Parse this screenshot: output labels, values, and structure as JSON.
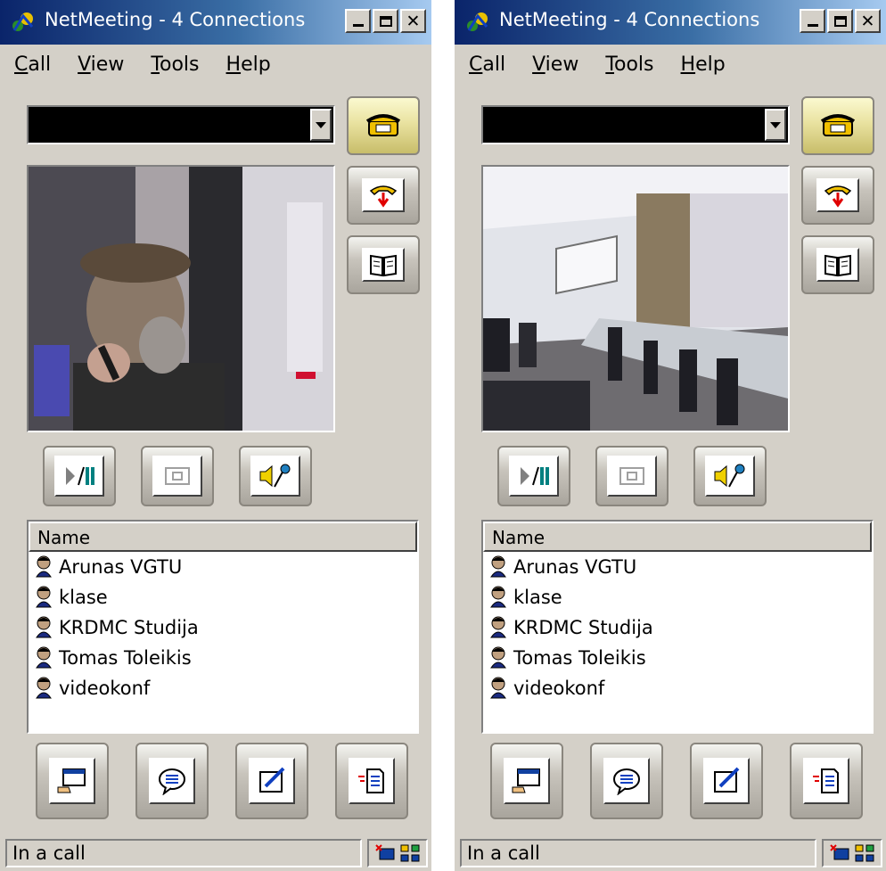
{
  "windows": [
    {
      "title": "NetMeeting - 4 Connections",
      "menu": [
        "Call",
        "View",
        "Tools",
        "Help"
      ],
      "list_header": "Name",
      "participants": [
        "Arunas VGTU",
        "klase",
        "KRDMC Studija",
        "Tomas Toleikis",
        "videokonf"
      ],
      "status": "In a call",
      "video_scene": "person-at-desk"
    },
    {
      "title": "NetMeeting - 4 Connections",
      "menu": [
        "Call",
        "View",
        "Tools",
        "Help"
      ],
      "list_header": "Name",
      "participants": [
        "Arunas VGTU",
        "klase",
        "KRDMC Studija",
        "Tomas Toleikis",
        "videokonf"
      ],
      "status": "In a call",
      "video_scene": "conference-room"
    }
  ],
  "icons": {
    "app": "netmeeting-icon",
    "call": "place-call-icon",
    "hangup": "end-call-icon",
    "directory": "directory-book-icon",
    "play_pause": "play-pause-icon",
    "pip": "picture-in-picture-icon",
    "audio": "adjust-audio-icon",
    "share": "share-program-icon",
    "chat": "chat-icon",
    "whiteboard": "whiteboard-icon",
    "transfer": "file-transfer-icon",
    "person": "participant-icon"
  },
  "colors": {
    "titlebar_start": "#0a246a",
    "titlebar_end": "#a6caf0",
    "window_bg": "#d4d0c8"
  }
}
